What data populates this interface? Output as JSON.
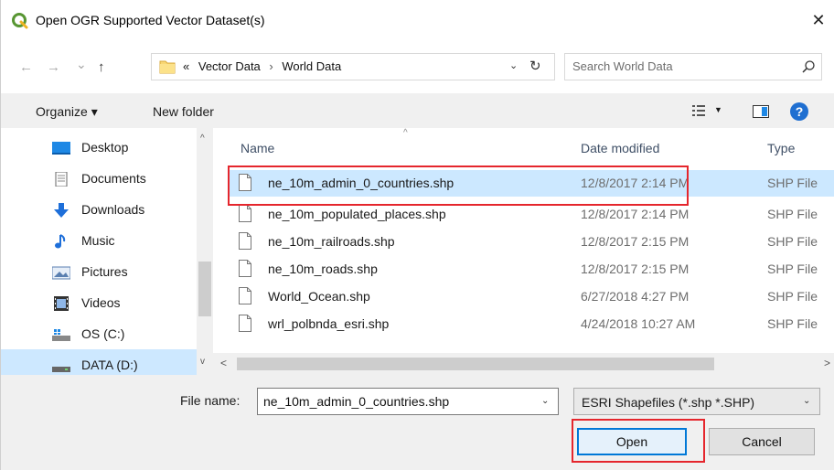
{
  "window": {
    "title": "Open OGR Supported Vector Dataset(s)",
    "close_glyph": "✕",
    "app_icon": "qgis-logo-icon"
  },
  "navigation": {
    "back_glyph": "←",
    "forward_glyph": "→",
    "recent_glyph": "⌄",
    "up_glyph": "↑"
  },
  "address": {
    "prefix": "«",
    "crumbs": [
      "Vector Data",
      "World Data"
    ],
    "separator": "›",
    "dropdown_glyph": "⌄",
    "refresh_glyph": "↻"
  },
  "search": {
    "placeholder": "Search World Data"
  },
  "toolbar": {
    "organize_label": "Organize ▾",
    "new_folder_label": "New folder",
    "view_dropdown_glyph": "▼",
    "help_label": "?"
  },
  "sidebar": {
    "items": [
      {
        "label": "Desktop",
        "icon": "desktop-icon"
      },
      {
        "label": "Documents",
        "icon": "documents-icon"
      },
      {
        "label": "Downloads",
        "icon": "downloads-icon"
      },
      {
        "label": "Music",
        "icon": "music-icon"
      },
      {
        "label": "Pictures",
        "icon": "pictures-icon"
      },
      {
        "label": "Videos",
        "icon": "videos-icon"
      },
      {
        "label": "OS (C:)",
        "icon": "drive-icon"
      },
      {
        "label": "DATA (D:)",
        "icon": "drive-icon"
      }
    ],
    "selected_index": 7,
    "scroll_up_glyph": "^",
    "scroll_down_glyph": "v"
  },
  "file_list": {
    "columns": {
      "name": "Name",
      "date": "Date modified",
      "type": "Type"
    },
    "rows": [
      {
        "name": "ne_10m_admin_0_countries.shp",
        "date": "12/8/2017 2:14 PM",
        "type": "SHP File"
      },
      {
        "name": "ne_10m_populated_places.shp",
        "date": "12/8/2017 2:14 PM",
        "type": "SHP File"
      },
      {
        "name": "ne_10m_railroads.shp",
        "date": "12/8/2017 2:15 PM",
        "type": "SHP File"
      },
      {
        "name": "ne_10m_roads.shp",
        "date": "12/8/2017 2:15 PM",
        "type": "SHP File"
      },
      {
        "name": "World_Ocean.shp",
        "date": "6/27/2018 4:27 PM",
        "type": "SHP File"
      },
      {
        "name": "wrl_polbnda_esri.shp",
        "date": "4/24/2018 10:27 AM",
        "type": "SHP File"
      }
    ],
    "selected_index": 0,
    "scroll_left_glyph": "<",
    "scroll_right_glyph": ">"
  },
  "footer": {
    "file_name_label": "File name:",
    "file_name_value": "ne_10m_admin_0_countries.shp",
    "file_name_dropdown_glyph": "⌄",
    "file_type_value": "ESRI Shapefiles (*.shp *.SHP)",
    "file_type_dropdown_glyph": "⌄",
    "open_label": "Open",
    "cancel_label": "Cancel"
  },
  "colors": {
    "selection": "#cce8ff",
    "annotation": "#e5262d",
    "accent": "#0078d7"
  }
}
